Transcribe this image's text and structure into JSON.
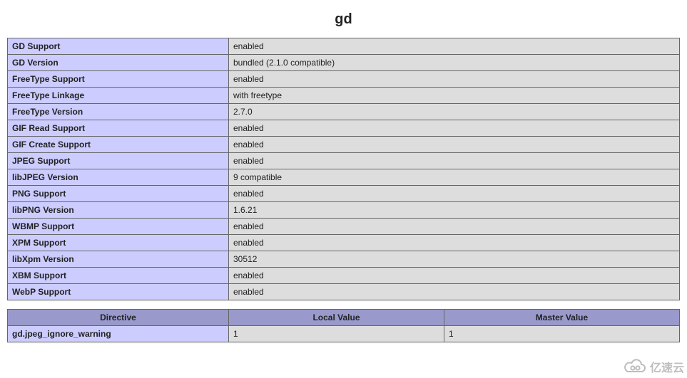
{
  "section_title": "gd",
  "info": {
    "rows": [
      {
        "label": "GD Support",
        "value": "enabled"
      },
      {
        "label": "GD Version",
        "value": "bundled (2.1.0 compatible)"
      },
      {
        "label": "FreeType Support",
        "value": "enabled"
      },
      {
        "label": "FreeType Linkage",
        "value": "with freetype"
      },
      {
        "label": "FreeType Version",
        "value": "2.7.0"
      },
      {
        "label": "GIF Read Support",
        "value": "enabled"
      },
      {
        "label": "GIF Create Support",
        "value": "enabled"
      },
      {
        "label": "JPEG Support",
        "value": "enabled"
      },
      {
        "label": "libJPEG Version",
        "value": "9 compatible"
      },
      {
        "label": "PNG Support",
        "value": "enabled"
      },
      {
        "label": "libPNG Version",
        "value": "1.6.21"
      },
      {
        "label": "WBMP Support",
        "value": "enabled"
      },
      {
        "label": "XPM Support",
        "value": "enabled"
      },
      {
        "label": "libXpm Version",
        "value": "30512"
      },
      {
        "label": "XBM Support",
        "value": "enabled"
      },
      {
        "label": "WebP Support",
        "value": "enabled"
      }
    ]
  },
  "directives": {
    "headers": {
      "directive": "Directive",
      "local": "Local Value",
      "master": "Master Value"
    },
    "rows": [
      {
        "directive": "gd.jpeg_ignore_warning",
        "local": "1",
        "master": "1"
      }
    ]
  },
  "watermark": {
    "text": "亿速云"
  }
}
